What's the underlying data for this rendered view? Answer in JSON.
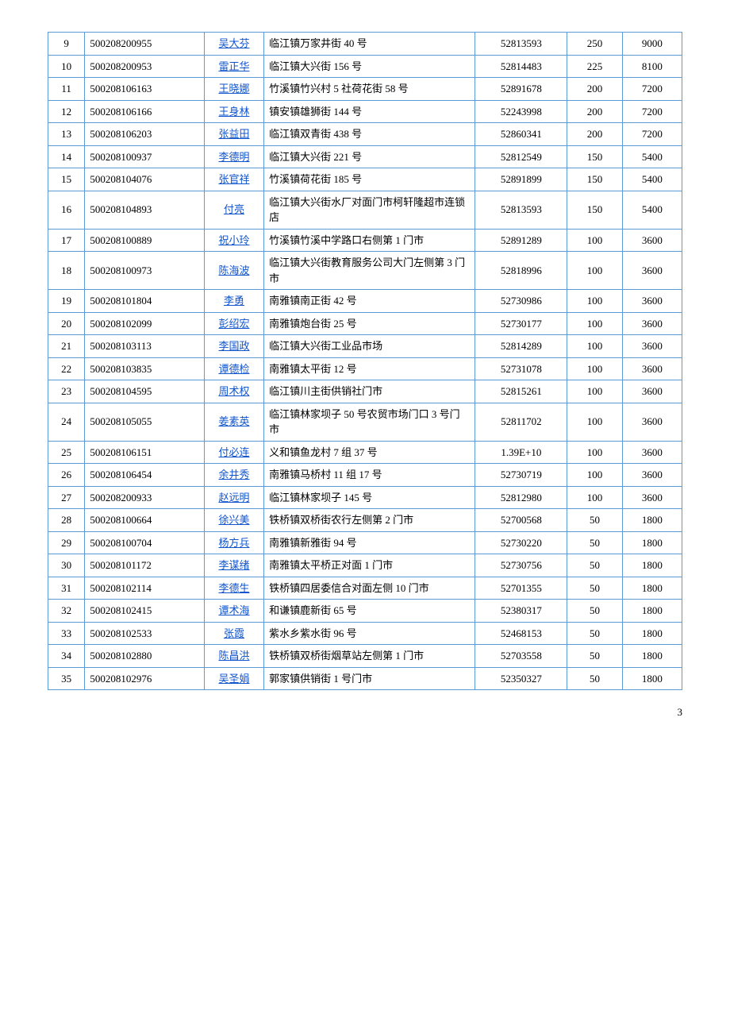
{
  "page": 3,
  "rows": [
    {
      "num": "9",
      "id": "500208200955",
      "name": "吴大芬",
      "address": "临江镇万家井街 40 号",
      "phone": "52813593",
      "amount": "250",
      "total": "9000"
    },
    {
      "num": "10",
      "id": "500208200953",
      "name": "雷正华",
      "address": "临江镇大兴街 156 号",
      "phone": "52814483",
      "amount": "225",
      "total": "8100"
    },
    {
      "num": "11",
      "id": "500208106163",
      "name": "王晓娜",
      "address": "竹溪镇竹兴村 5 社荷花街 58 号",
      "phone": "52891678",
      "amount": "200",
      "total": "7200"
    },
    {
      "num": "12",
      "id": "500208106166",
      "name": "王身林",
      "address": "镇安镇雄狮街 144 号",
      "phone": "52243998",
      "amount": "200",
      "total": "7200"
    },
    {
      "num": "13",
      "id": "500208106203",
      "name": "张益田",
      "address": "临江镇双青街 438 号",
      "phone": "52860341",
      "amount": "200",
      "total": "7200"
    },
    {
      "num": "14",
      "id": "500208100937",
      "name": "李德明",
      "address": "临江镇大兴街 221 号",
      "phone": "52812549",
      "amount": "150",
      "total": "5400"
    },
    {
      "num": "15",
      "id": "500208104076",
      "name": "张官祥",
      "address": "竹溪镇荷花街 185 号",
      "phone": "52891899",
      "amount": "150",
      "total": "5400"
    },
    {
      "num": "16",
      "id": "500208104893",
      "name": "付亮",
      "address": "临江镇大兴街水厂对面门市柯轩隆超市连锁店",
      "phone": "52813593",
      "amount": "150",
      "total": "5400"
    },
    {
      "num": "17",
      "id": "500208100889",
      "name": "祝小玲",
      "address": "竹溪镇竹溪中学路口右侧第 1 门市",
      "phone": "52891289",
      "amount": "100",
      "total": "3600"
    },
    {
      "num": "18",
      "id": "500208100973",
      "name": "陈海波",
      "address": "临江镇大兴街教育服务公司大门左侧第 3 门市",
      "phone": "52818996",
      "amount": "100",
      "total": "3600"
    },
    {
      "num": "19",
      "id": "500208101804",
      "name": "李勇",
      "address": "南雅镇南正街 42 号",
      "phone": "52730986",
      "amount": "100",
      "total": "3600"
    },
    {
      "num": "20",
      "id": "500208102099",
      "name": "彭绍宏",
      "address": "南雅镇炮台街 25 号",
      "phone": "52730177",
      "amount": "100",
      "total": "3600"
    },
    {
      "num": "21",
      "id": "500208103113",
      "name": "李国政",
      "address": "临江镇大兴街工业品市场",
      "phone": "52814289",
      "amount": "100",
      "total": "3600"
    },
    {
      "num": "22",
      "id": "500208103835",
      "name": "谭德检",
      "address": "南雅镇太平街 12 号",
      "phone": "52731078",
      "amount": "100",
      "total": "3600"
    },
    {
      "num": "23",
      "id": "500208104595",
      "name": "周术权",
      "address": "临江镇川主街供销社门市",
      "phone": "52815261",
      "amount": "100",
      "total": "3600"
    },
    {
      "num": "24",
      "id": "500208105055",
      "name": "姜素英",
      "address": "临江镇林家坝子 50 号农贸市场门口 3 号门市",
      "phone": "52811702",
      "amount": "100",
      "total": "3600"
    },
    {
      "num": "25",
      "id": "500208106151",
      "name": "付必连",
      "address": "义和镇鱼龙村 7 组 37 号",
      "phone": "1.39E+10",
      "amount": "100",
      "total": "3600"
    },
    {
      "num": "26",
      "id": "500208106454",
      "name": "余井秀",
      "address": "南雅镇马桥村 11 组 17 号",
      "phone": "52730719",
      "amount": "100",
      "total": "3600"
    },
    {
      "num": "27",
      "id": "500208200933",
      "name": "赵远明",
      "address": "临江镇林家坝子 145 号",
      "phone": "52812980",
      "amount": "100",
      "total": "3600"
    },
    {
      "num": "28",
      "id": "500208100664",
      "name": "徐兴美",
      "address": "铁桥镇双桥街农行左侧第 2 门市",
      "phone": "52700568",
      "amount": "50",
      "total": "1800"
    },
    {
      "num": "29",
      "id": "500208100704",
      "name": "杨方兵",
      "address": "南雅镇新雅街 94 号",
      "phone": "52730220",
      "amount": "50",
      "total": "1800"
    },
    {
      "num": "30",
      "id": "500208101172",
      "name": "李谋绪",
      "address": "南雅镇太平桥正对面 1 门市",
      "phone": "52730756",
      "amount": "50",
      "total": "1800"
    },
    {
      "num": "31",
      "id": "500208102114",
      "name": "李德生",
      "address": "铁桥镇四居委信合对面左侧 10 门市",
      "phone": "52701355",
      "amount": "50",
      "total": "1800"
    },
    {
      "num": "32",
      "id": "500208102415",
      "name": "谭术海",
      "address": "和谦镇鹿新街 65 号",
      "phone": "52380317",
      "amount": "50",
      "total": "1800"
    },
    {
      "num": "33",
      "id": "500208102533",
      "name": "张霞",
      "address": "紫水乡紫水街 96 号",
      "phone": "52468153",
      "amount": "50",
      "total": "1800"
    },
    {
      "num": "34",
      "id": "500208102880",
      "name": "陈昌洪",
      "address": "铁桥镇双桥街烟草站左侧第 1 门市",
      "phone": "52703558",
      "amount": "50",
      "total": "1800"
    },
    {
      "num": "35",
      "id": "500208102976",
      "name": "吴圣娟",
      "address": "郭家镇供销街 1 号门市",
      "phone": "52350327",
      "amount": "50",
      "total": "1800"
    }
  ]
}
